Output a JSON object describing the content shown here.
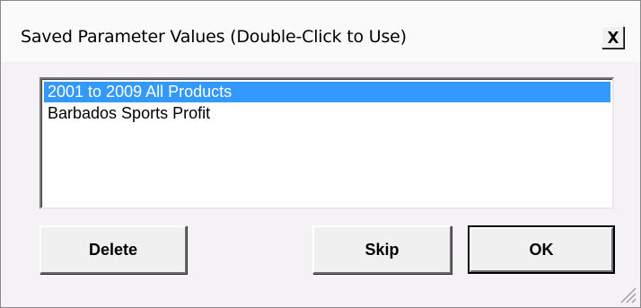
{
  "dialog": {
    "title": "Saved Parameter Values (Double-Click to Use)",
    "close_icon": "close-x-icon"
  },
  "list": {
    "items": [
      {
        "label": "2001 to 2009 All Products",
        "selected": true
      },
      {
        "label": "Barbados Sports Profit",
        "selected": false
      }
    ]
  },
  "buttons": {
    "delete_label": "Delete",
    "skip_label": "Skip",
    "ok_label": "OK"
  },
  "colors": {
    "selection": "#3399ff",
    "dialog_bg": "#f4f2f5"
  }
}
